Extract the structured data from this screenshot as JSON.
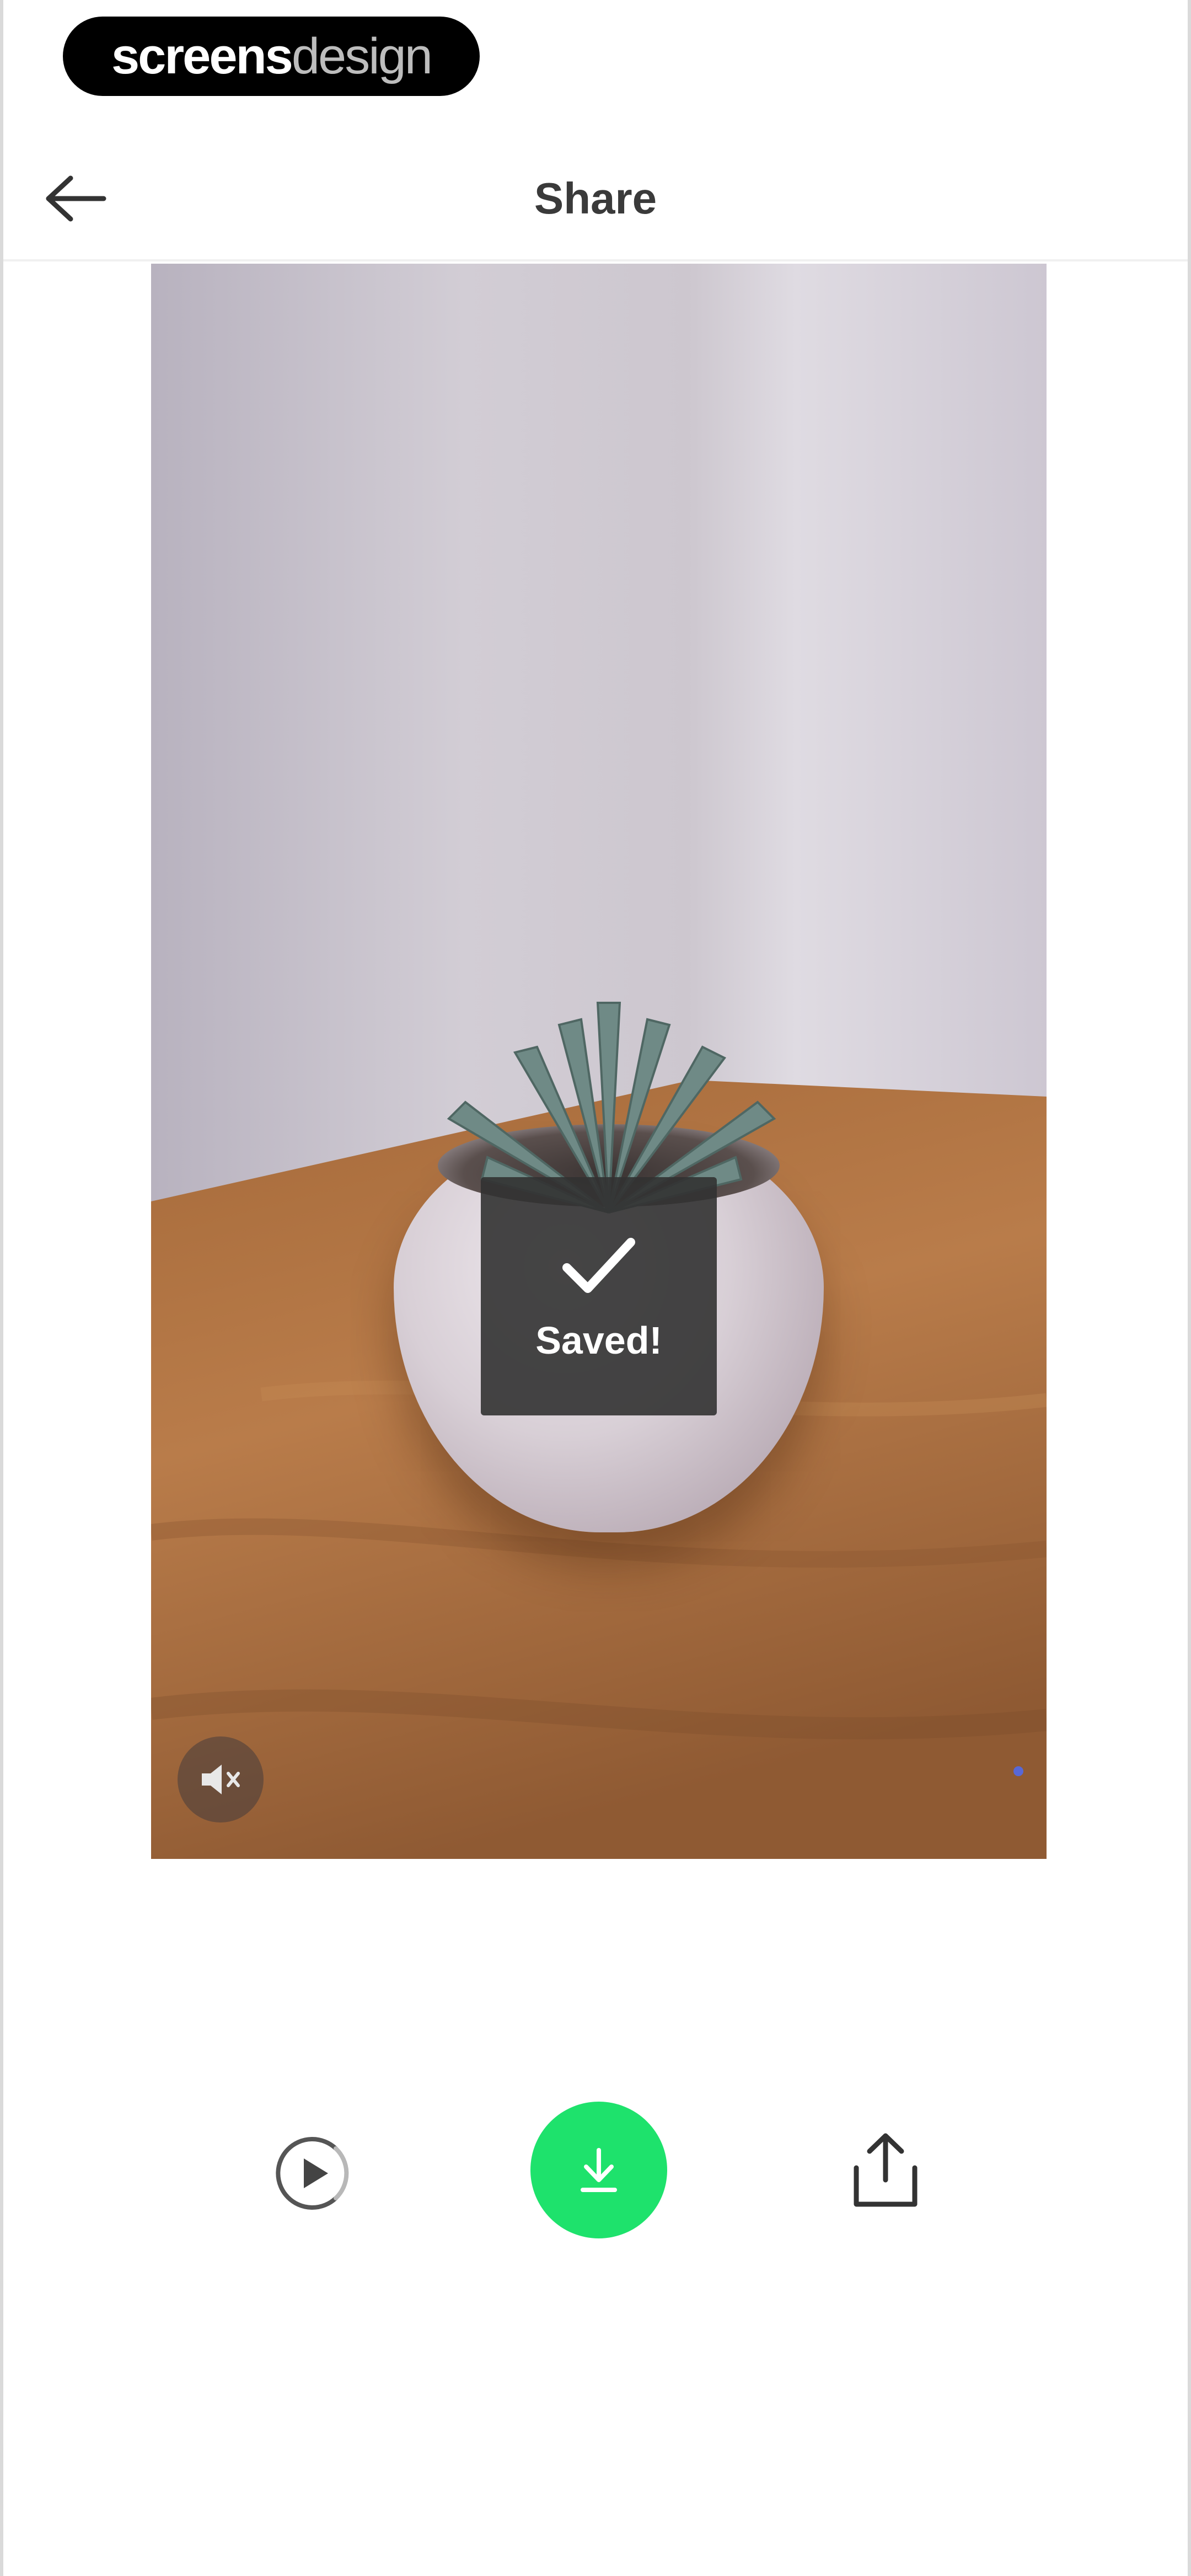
{
  "brand": {
    "part1": "screens",
    "part2": "design"
  },
  "header": {
    "title": "Share",
    "back_icon": "arrow-left-icon"
  },
  "preview": {
    "toast_label": "Saved!",
    "toast_icon": "checkmark-icon",
    "mute_icon": "speaker-muted-icon",
    "accent_dot_color": "#4a6cff"
  },
  "actions": {
    "items": [
      {
        "icon": "play-icon"
      },
      {
        "icon": "download-icon",
        "color": "#1ee26c"
      },
      {
        "icon": "share-icon"
      }
    ]
  },
  "colors": {
    "accent": "#1ee26c",
    "title_text": "#3a3a3a",
    "toast_bg": "#323232"
  }
}
